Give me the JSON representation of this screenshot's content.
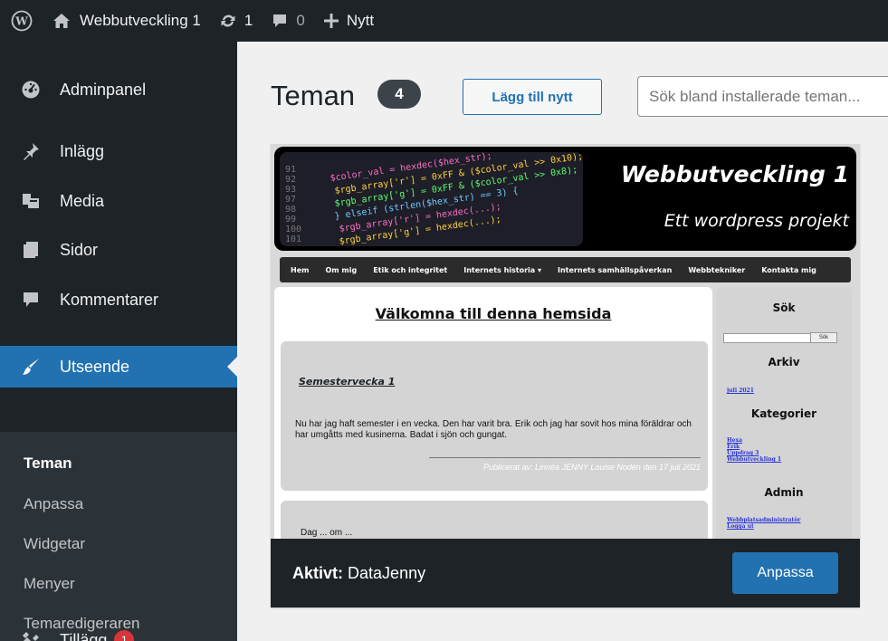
{
  "adminbar": {
    "site_name": "Webbutveckling 1",
    "updates_count": "1",
    "comments_count": "0",
    "new_label": "Nytt"
  },
  "sidebar": {
    "items": [
      {
        "label": "Adminpanel",
        "icon": "dashboard-icon"
      },
      {
        "label": "Inlägg",
        "icon": "pin-icon"
      },
      {
        "label": "Media",
        "icon": "media-icon"
      },
      {
        "label": "Sidor",
        "icon": "pages-icon"
      },
      {
        "label": "Kommentarer",
        "icon": "comment-icon"
      },
      {
        "label": "Utseende",
        "icon": "brush-icon",
        "current": true
      },
      {
        "label": "Tillägg",
        "icon": "plugin-icon",
        "badge": "1"
      }
    ],
    "submenu": [
      {
        "label": "Teman",
        "current": true
      },
      {
        "label": "Anpassa"
      },
      {
        "label": "Widgetar"
      },
      {
        "label": "Menyer"
      },
      {
        "label": "Temaredigeraren"
      }
    ]
  },
  "main": {
    "title": "Teman",
    "theme_count": "4",
    "add_new_label": "Lägg till nytt",
    "search_placeholder": "Sök bland installerade teman..."
  },
  "theme": {
    "active_prefix": "Aktivt:",
    "name": "DataJenny",
    "customize_label": "Anpassa",
    "screenshot": {
      "site_title": "Webbutveckling 1",
      "tagline": "Ett wordpress projekt",
      "nav": [
        "Hem",
        "Om mig",
        "Etik och integritet",
        "Internets historia ▾",
        "Internets samhällspåverkan",
        "Webbtekniker",
        "Kontakta mig"
      ],
      "welcome": "Välkomna till denna hemsida",
      "post_title": "Semestervecka 1",
      "post_excerpt": "Nu har jag haft semester i en vecka. Den har varit bra. Erik och jag har sovit hos mina föräldrar och har umgåtts med kusinerna. Badat i sjön och gungat.",
      "post_meta": "Publicerat av: Linnéa JENNY Louise Nodén den 17 juli 2021",
      "post2_title": "Dag ... om ...",
      "sidebar_search": "Sök",
      "search_btn": "Sök",
      "archive_head": "Arkiv",
      "archive_link": "juli 2021",
      "categories_head": "Kategorier",
      "categories": [
        "Hexa",
        "Erik",
        "Uppdrag 3",
        "Webbutveckling 1"
      ],
      "admin_head": "Admin",
      "admin_links": [
        "Webbplatsadministratör",
        "Logga ut"
      ]
    }
  },
  "colors": {
    "accent": "#2271b1",
    "admin_dark": "#1d2327",
    "badge_red": "#d63638"
  }
}
